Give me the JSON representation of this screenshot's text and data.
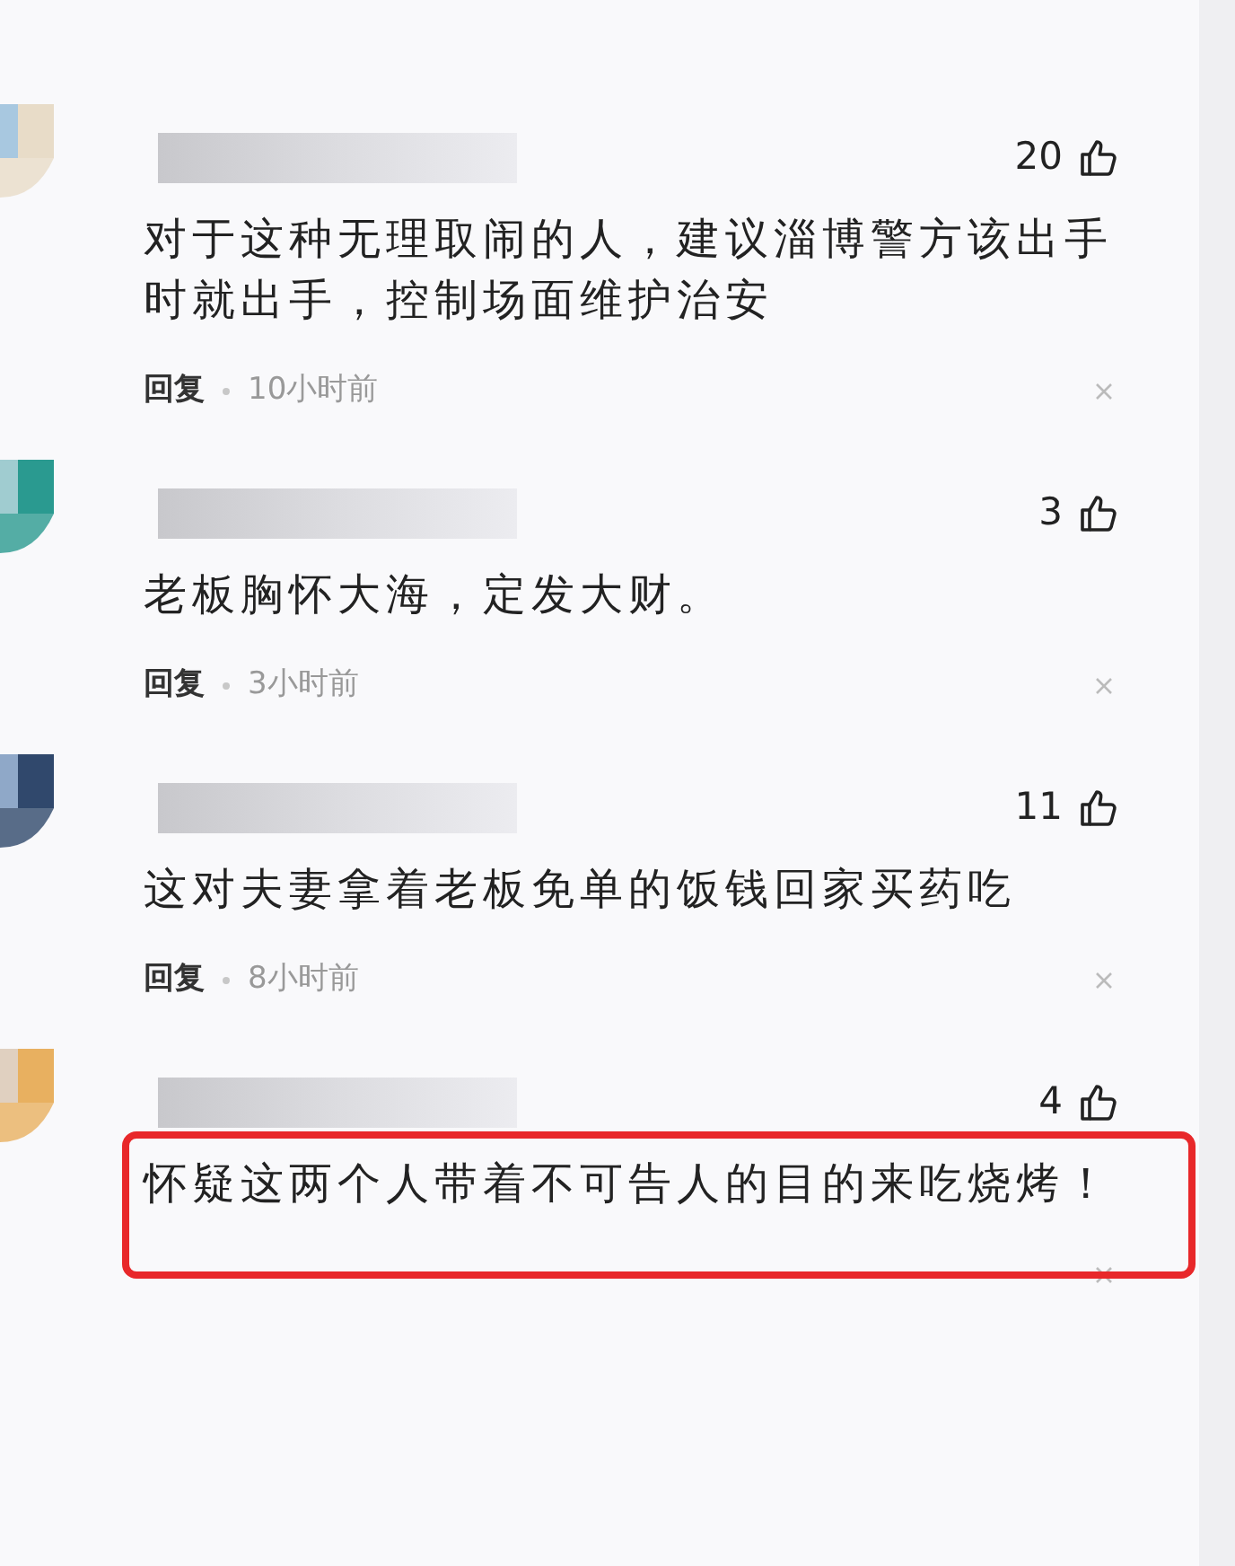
{
  "comments": [
    {
      "likes": "20",
      "text": "对于这种无理取闹的人，建议淄博警方该出手时就出手，控制场面维护治安",
      "reply": "回复",
      "time": "10小时前",
      "highlighted": false
    },
    {
      "likes": "3",
      "text": "老板胸怀大海，定发大财。",
      "reply": "回复",
      "time": "3小时前",
      "highlighted": false
    },
    {
      "likes": "11",
      "text": "这对夫妻拿着老板免单的饭钱回家买药吃",
      "reply": "回复",
      "time": "8小时前",
      "highlighted": false
    },
    {
      "likes": "4",
      "text": "怀疑这两个人带着不可告人的目的来吃烧烤！",
      "highlighted": true
    }
  ]
}
